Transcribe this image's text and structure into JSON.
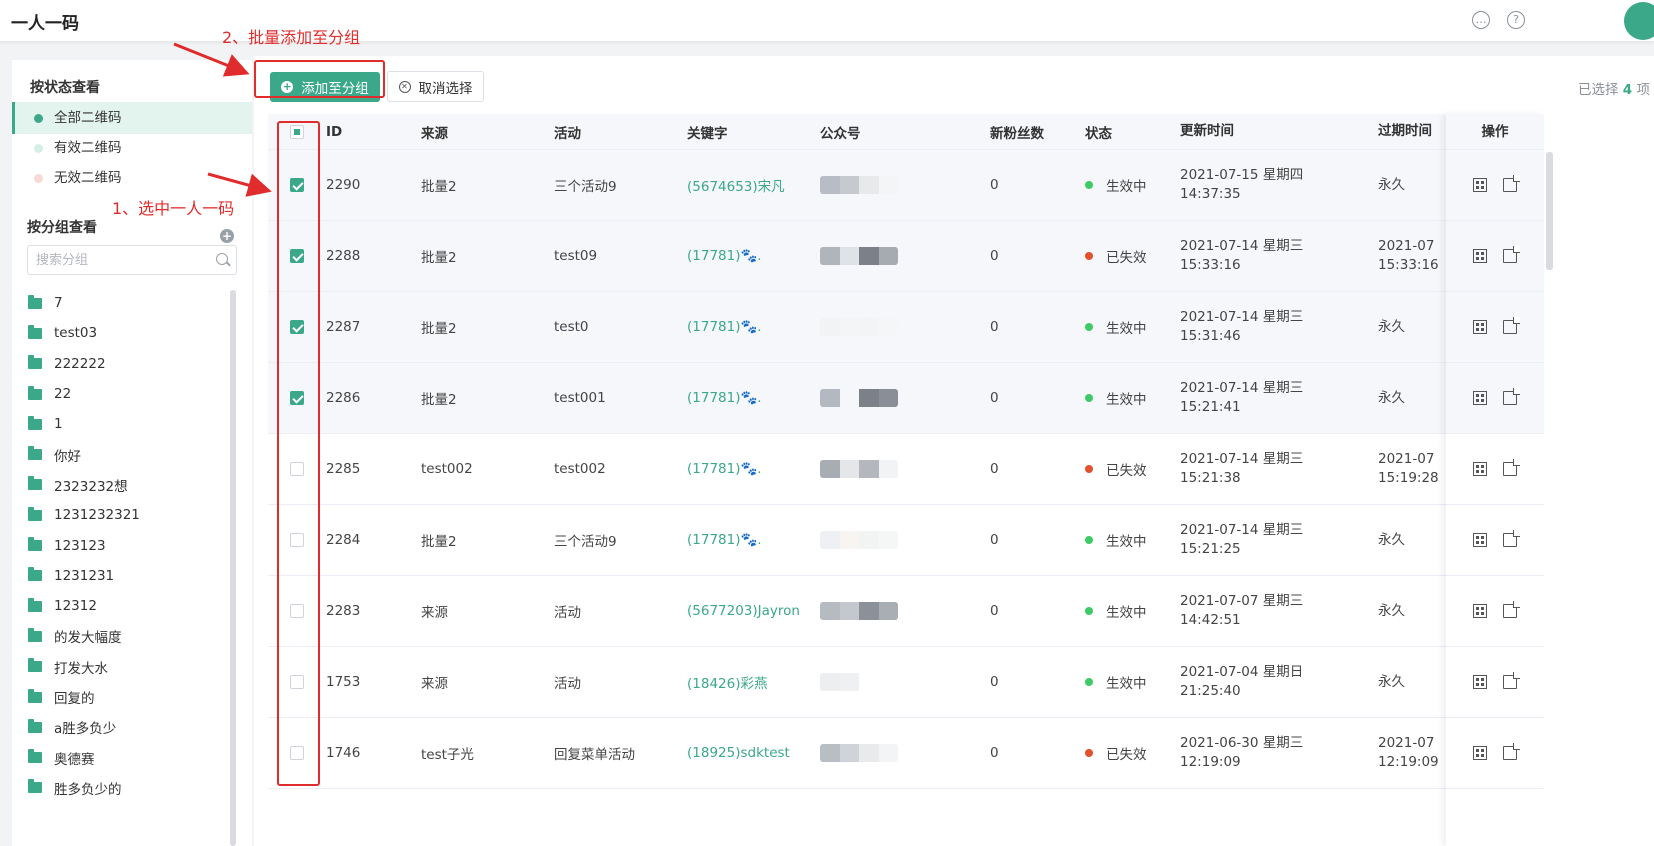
{
  "app_title": "一人一码",
  "colors": {
    "accent": "#3aa889",
    "valid": "#3ecb65",
    "invalid": "#e2502c",
    "annotation": "#e02c2c"
  },
  "topbar_icons": [
    "chat-icon",
    "help-icon",
    "avatar"
  ],
  "sidebar": {
    "status_title": "按状态查看",
    "status_items": [
      {
        "label": "全部二维码",
        "dot_color": "#3aa889",
        "active": true
      },
      {
        "label": "有效二维码",
        "dot_color": "#d6efe4",
        "active": false
      },
      {
        "label": "无效二维码",
        "dot_color": "#f7d9d6",
        "active": false
      }
    ],
    "group_title": "按分组查看",
    "search_placeholder": "搜索分组",
    "groups": [
      "7",
      "test03",
      "222222",
      "22",
      "1",
      "你好",
      "2323232想",
      "1231232321",
      "123123",
      "1231231",
      "12312",
      "的发大幅度",
      "打发大水",
      "回复的",
      "a胜多负少",
      "奥德赛",
      "胜多负少的"
    ]
  },
  "toolbar": {
    "add_label": "添加至分组",
    "cancel_label": "取消选择",
    "selected_prefix": "已选择",
    "selected_count": "4",
    "selected_suffix": "项"
  },
  "table": {
    "headers": [
      "ID",
      "来源",
      "活动",
      "关键字",
      "公众号",
      "新粉丝数",
      "状态",
      "更新时间",
      "过期时间",
      "操作"
    ],
    "rows": [
      {
        "checked": true,
        "id": "2290",
        "source": "批量2",
        "activity": "三个活动9",
        "keyword": "(5674653)宋凡",
        "fans": "0",
        "status": "生效中",
        "status_type": "valid",
        "updated_date": "2021-07-15 星期四",
        "updated_time": "14:37:35",
        "expire_date": "永久",
        "expire_time": "",
        "blur": [
          "#b8bcc4",
          "#c6c9ce",
          "#e8e9eb",
          "#f4f5f6"
        ]
      },
      {
        "checked": true,
        "id": "2288",
        "source": "批量2",
        "activity": "test09",
        "keyword": "(17781)🐾.",
        "fans": "0",
        "status": "已失效",
        "status_type": "invalid",
        "updated_date": "2021-07-14 星期三",
        "updated_time": "15:33:16",
        "expire_date": "2021-07",
        "expire_time": "15:33:16",
        "blur": [
          "#b0b4bb",
          "#dfe2e6",
          "#7c8089",
          "#a6aab1"
        ]
      },
      {
        "checked": true,
        "id": "2287",
        "source": "批量2",
        "activity": "test0",
        "keyword": "(17781)🐾.",
        "fans": "0",
        "status": "生效中",
        "status_type": "valid",
        "updated_date": "2021-07-14 星期三",
        "updated_time": "15:31:46",
        "expire_date": "永久",
        "expire_time": "",
        "blur": [
          "#f2f3f5",
          "#f4f5f7",
          "#f3f4f6",
          "#f5f6f8"
        ]
      },
      {
        "checked": true,
        "id": "2286",
        "source": "批量2",
        "activity": "test001",
        "keyword": "(17781)🐾.",
        "fans": "0",
        "status": "生效中",
        "status_type": "valid",
        "updated_date": "2021-07-14 星期三",
        "updated_time": "15:21:41",
        "expire_date": "永久",
        "expire_time": "",
        "blur": [
          "#b4b8c0",
          "#f5f7fa",
          "#7c8089",
          "#8a8e96"
        ]
      },
      {
        "checked": false,
        "id": "2285",
        "source": "test002",
        "activity": "test002",
        "keyword": "(17781)🐾.",
        "fans": "0",
        "status": "已失效",
        "status_type": "invalid",
        "updated_date": "2021-07-14 星期三",
        "updated_time": "15:21:38",
        "expire_date": "2021-07",
        "expire_time": "15:19:28",
        "blur": [
          "#a8acb3",
          "#e4e6e9",
          "#b4b7bd",
          "#f2f3f5"
        ]
      },
      {
        "checked": false,
        "id": "2284",
        "source": "批量2",
        "activity": "三个活动9",
        "keyword": "(17781)🐾.",
        "fans": "0",
        "status": "生效中",
        "status_type": "valid",
        "updated_date": "2021-07-14 星期三",
        "updated_time": "15:21:25",
        "expire_date": "永久",
        "expire_time": "",
        "blur": [
          "#eef0f4",
          "#f7f4f2",
          "#f2f4f3",
          "#f5f6f6"
        ]
      },
      {
        "checked": false,
        "id": "2283",
        "source": "来源",
        "activity": "活动",
        "keyword": "(5677203)Jayron",
        "fans": "0",
        "status": "生效中",
        "status_type": "valid",
        "updated_date": "2021-07-07 星期三",
        "updated_time": "14:42:51",
        "expire_date": "永久",
        "expire_time": "",
        "blur": [
          "#b6bac1",
          "#c4c7cd",
          "#8c9098",
          "#a9adb4"
        ]
      },
      {
        "checked": false,
        "id": "1753",
        "source": "来源",
        "activity": "活动",
        "keyword": "(18426)彩燕",
        "fans": "0",
        "status": "生效中",
        "status_type": "valid",
        "updated_date": "2021-07-04 星期日",
        "updated_time": "21:25:40",
        "expire_date": "永久",
        "expire_time": "",
        "blur": [
          "#eceef0",
          "#eef0f2",
          "#ffffff",
          "#ffffff"
        ]
      },
      {
        "checked": false,
        "id": "1746",
        "source": "test子光",
        "activity": "回复菜单活动",
        "keyword": "(18925)sdktest",
        "fans": "0",
        "status": "已失效",
        "status_type": "invalid",
        "updated_date": "2021-06-30 星期三",
        "updated_time": "12:19:09",
        "expire_date": "2021-07",
        "expire_time": "12:19:09",
        "blur": [
          "#b9bdc4",
          "#d0d3d8",
          "#e9eaec",
          "#f3f4f5"
        ]
      }
    ]
  },
  "annotations": {
    "note_1": "1、选中一人一码",
    "note_2": "2、批量添加至分组"
  }
}
